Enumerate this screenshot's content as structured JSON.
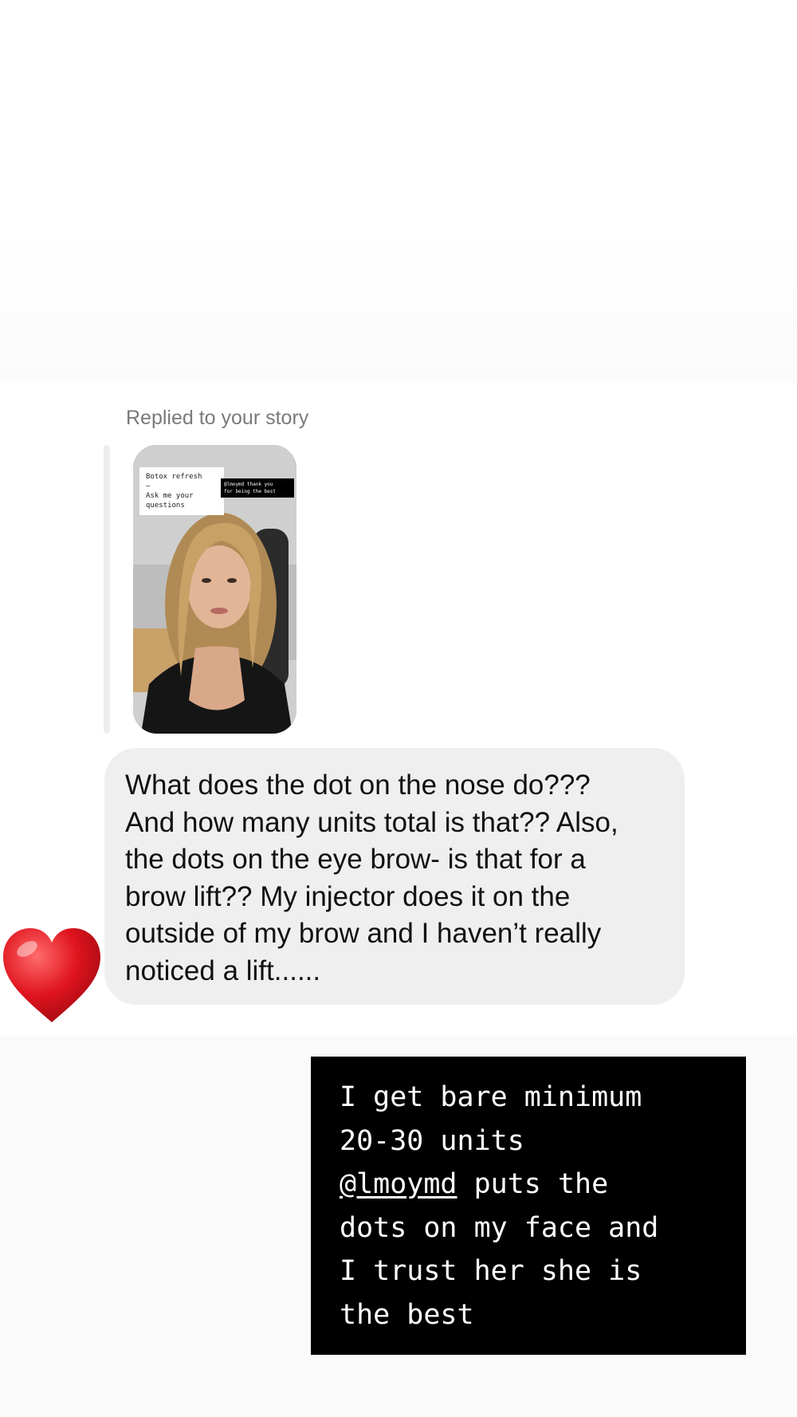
{
  "thread": {
    "replied_label": "Replied to your story",
    "story": {
      "sticker_main": "Botox refresh\n—\nAsk me your\nquestions",
      "sticker_tag": "@lmoymd thank you\nfor being the best"
    },
    "message": "What does the dot on the nose do???\nAnd how many units total is that?? Also,\nthe dots on the eye brow- is that for a\nbrow lift?? My injector does it on the\noutside of my brow and I haven’t really\nnoticed a lift......",
    "reaction": "heart-emoji"
  },
  "caption": {
    "lines": [
      {
        "pre": "I get bare minimum",
        "mention": "",
        "post": ""
      },
      {
        "pre": "20-30 units",
        "mention": "",
        "post": ""
      },
      {
        "pre": "",
        "mention": "@lmoymd",
        "post": " puts the"
      },
      {
        "pre": "dots on my face and",
        "mention": "",
        "post": ""
      },
      {
        "pre": "I trust her she is",
        "mention": "",
        "post": ""
      },
      {
        "pre": "the best",
        "mention": "",
        "post": ""
      }
    ]
  },
  "colors": {
    "bubble_bg": "#efefef",
    "caption_bg": "#000000",
    "heart": "#e0141e"
  }
}
